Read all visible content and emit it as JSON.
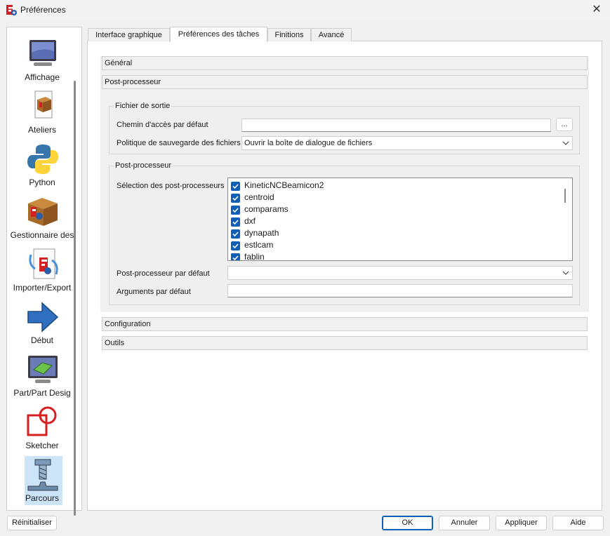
{
  "window": {
    "title": "Préférences",
    "close_glyph": "✕"
  },
  "sidebar": {
    "items": [
      {
        "label": "Affichage",
        "icon": "monitor-icon"
      },
      {
        "label": "Ateliers",
        "icon": "workbench-box-icon"
      },
      {
        "label": "Python",
        "icon": "python-icon"
      },
      {
        "label": "Gestionnaire des",
        "icon": "addon-manager-icon"
      },
      {
        "label": "Importer/Export",
        "icon": "import-export-icon"
      },
      {
        "label": "Début",
        "icon": "arrow-right-icon"
      },
      {
        "label": "Part/Part Desig",
        "icon": "part-design-icon"
      },
      {
        "label": "Sketcher",
        "icon": "sketcher-icon"
      },
      {
        "label": "Parcours",
        "icon": "path-milling-icon",
        "selected": true
      }
    ]
  },
  "tabs": [
    {
      "label": "Interface graphique"
    },
    {
      "label": "Préférences des tâches",
      "active": true
    },
    {
      "label": "Finitions"
    },
    {
      "label": "Avancé"
    }
  ],
  "sections": {
    "general": "Général",
    "post_processor": "Post-processeur",
    "configuration": "Configuration",
    "tools": "Outils"
  },
  "output_file": {
    "group_title": "Fichier de sortie",
    "path_label": "Chemin d'accès par défaut",
    "path_value": "",
    "browse_label": "...",
    "save_policy_label": "Politique de sauvegarde des fichiers",
    "save_policy_value": "Ouvrir la boîte de dialogue de fichiers"
  },
  "post_processor": {
    "group_title": "Post-processeur",
    "selection_label": "Sélection des post-processeurs",
    "items": [
      {
        "name": "KineticNCBeamicon2",
        "checked": true
      },
      {
        "name": "centroid",
        "checked": true
      },
      {
        "name": "comparams",
        "checked": true
      },
      {
        "name": "dxf",
        "checked": true
      },
      {
        "name": "dynapath",
        "checked": true
      },
      {
        "name": "estlcam",
        "checked": true
      },
      {
        "name": "fablin",
        "checked": true
      }
    ],
    "default_label": "Post-processeur par défaut",
    "default_value": "",
    "args_label": "Arguments par défaut",
    "args_value": ""
  },
  "buttons": {
    "reset": "Réinitialiser",
    "ok": "OK",
    "cancel": "Annuler",
    "apply": "Appliquer",
    "help": "Aide"
  },
  "colors": {
    "accent": "#0f5fb8",
    "selection": "#cce4f7"
  }
}
